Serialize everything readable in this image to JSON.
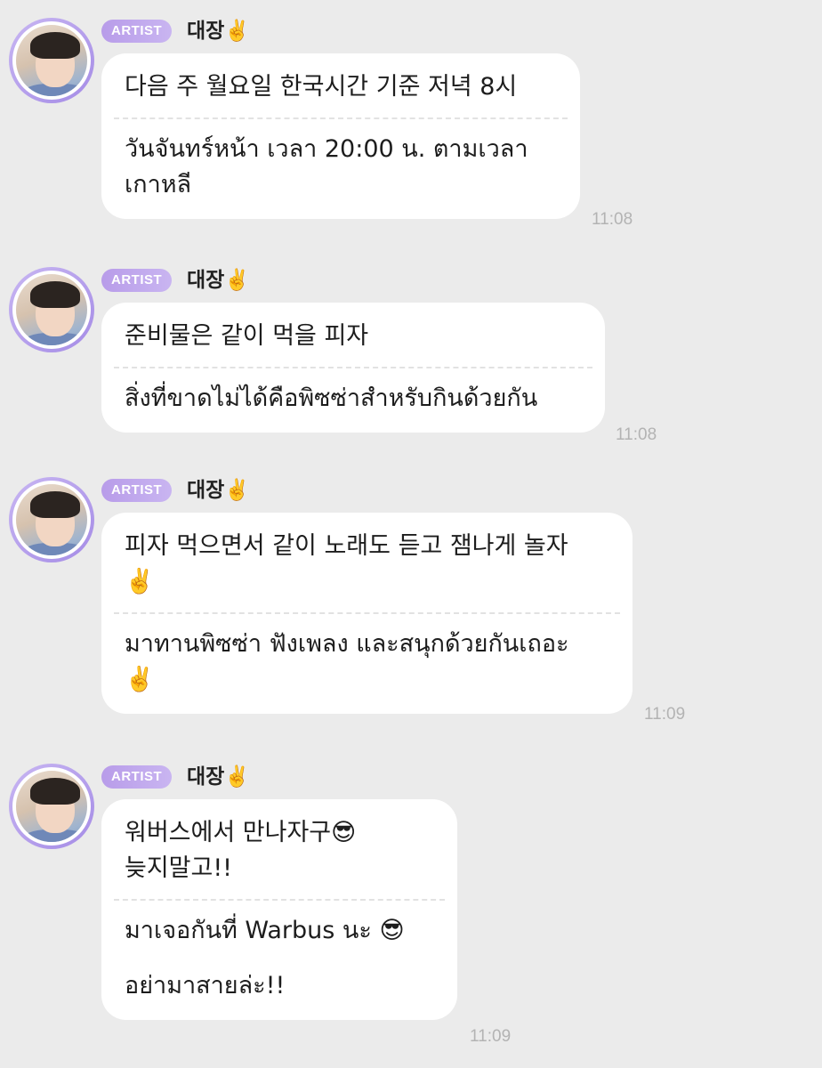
{
  "messages": [
    {
      "badge": "ARTIST",
      "sender": "대장✌️",
      "korean": [
        "다음 주 월요일 한국시간 기준 저녁 8시"
      ],
      "thai": [
        "วันจันทร์หน้า เวลา 20:00 น. ตามเวลา",
        "เกาหลี"
      ],
      "time": "11:08"
    },
    {
      "badge": "ARTIST",
      "sender": "대장✌️",
      "korean": [
        "준비물은 같이 먹을 피자"
      ],
      "thai": [
        "สิ่งที่ขาดไม่ได้คือพิซซ่าสำหรับกินด้วยกัน"
      ],
      "time": "11:08"
    },
    {
      "badge": "ARTIST",
      "sender": "대장✌️",
      "korean": [
        "피자 먹으면서 같이 노래도 듣고 잼나게 놀자",
        "✌️"
      ],
      "thai": [
        "มาทานพิซซ่า ฟังเพลง และสนุกด้วยกันเถอะ",
        "✌️"
      ],
      "time": "11:09"
    },
    {
      "badge": "ARTIST",
      "sender": "대장✌️",
      "korean": [
        "워버스에서 만나자구😎",
        "늦지말고!!"
      ],
      "thai": [
        "มาเจอกันที่ Warbus นะ 😎",
        "",
        "อย่ามาสายล่ะ!!"
      ],
      "time": "11:09"
    }
  ]
}
